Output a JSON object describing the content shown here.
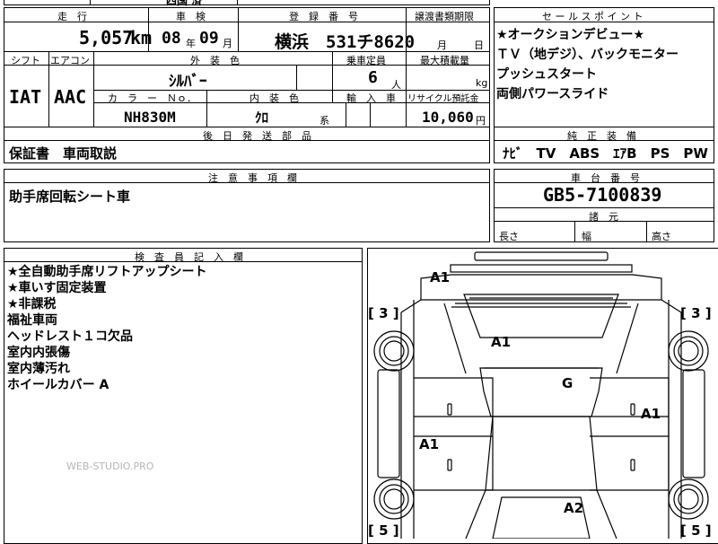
{
  "top_partial": {
    "left": "",
    "middle": "四国 済",
    "right": ""
  },
  "mileage": {
    "label": "走　行",
    "value": "5,057",
    "unit": "km"
  },
  "inspection": {
    "label": "車　検",
    "year": "08",
    "year_unit": "年",
    "month": "09",
    "month_unit": "月"
  },
  "registration": {
    "label": "登　録　番　号",
    "value": "横浜　531チ8620"
  },
  "transfer_deadline": {
    "label": "譲渡書類期限",
    "month_unit": "月",
    "day_unit": "日"
  },
  "shift": {
    "label": "シフト",
    "value": "IAT"
  },
  "aircon": {
    "label": "エアコン",
    "value": "AAC"
  },
  "exterior_color": {
    "label": "外　装　色",
    "value": "ｼﾙﾊﾞｰ"
  },
  "capacity": {
    "label": "乗車定員",
    "value": "6",
    "unit": "人"
  },
  "max_load": {
    "label": "最大積載量",
    "value": "",
    "unit": "kg"
  },
  "color_no": {
    "label": "カ　ラ　ー　Ｎｏ．",
    "value": "NH830M"
  },
  "interior_color": {
    "label": "内　装　色",
    "value": "ｸﾛ",
    "suffix": "系"
  },
  "import_car": {
    "label": "輸　入　車",
    "value": ""
  },
  "recycle": {
    "label": "リサイクル預託金",
    "value": "10,060",
    "unit": "円"
  },
  "later_parts": {
    "label": "後　日　発　送　部　品",
    "value": "保証書　車両取説"
  },
  "sales_points": {
    "label": "セ ー ル ス ポ イ ン ト",
    "lines": [
      "★オークションデビュー★",
      "ＴＶ（地デジ）、バックモニター",
      "プッシュスタート",
      "両側パワースライド"
    ]
  },
  "equipment": {
    "label": "純　正　装　備",
    "value": "ﾅﾋﾞ　TV　ABS　ｴｱB　PS　PW"
  },
  "notes": {
    "label": "注　意　事　項　欄",
    "value": "助手席回転シート車"
  },
  "chassis": {
    "label": "車　台　番　号",
    "value": "GB5-7100839"
  },
  "dimensions": {
    "label": "諸　元",
    "length": "長さ",
    "width": "幅",
    "height": "高さ"
  },
  "inspector": {
    "label": "検　査　員　記　入　欄",
    "lines": [
      "★全自動助手席リフトアップシート",
      "★車いす固定装置",
      "★非課税",
      "福祉車両",
      "ヘッドレスト１コ欠品",
      "室内内張傷",
      "室内薄汚れ",
      "ホイールカバー A"
    ]
  },
  "watermark": "WEB-STUDIO.PRO",
  "diagram": {
    "marks": {
      "front": "A1",
      "hood": "A1",
      "roof": "G",
      "right_door": "A1",
      "left_door": "A1",
      "rear": "A2"
    },
    "tires": {
      "fl": "[ 3 ]",
      "fr": "[ 3 ]",
      "rl": "[ 5 ]",
      "rr": "[ 5 ]"
    }
  }
}
